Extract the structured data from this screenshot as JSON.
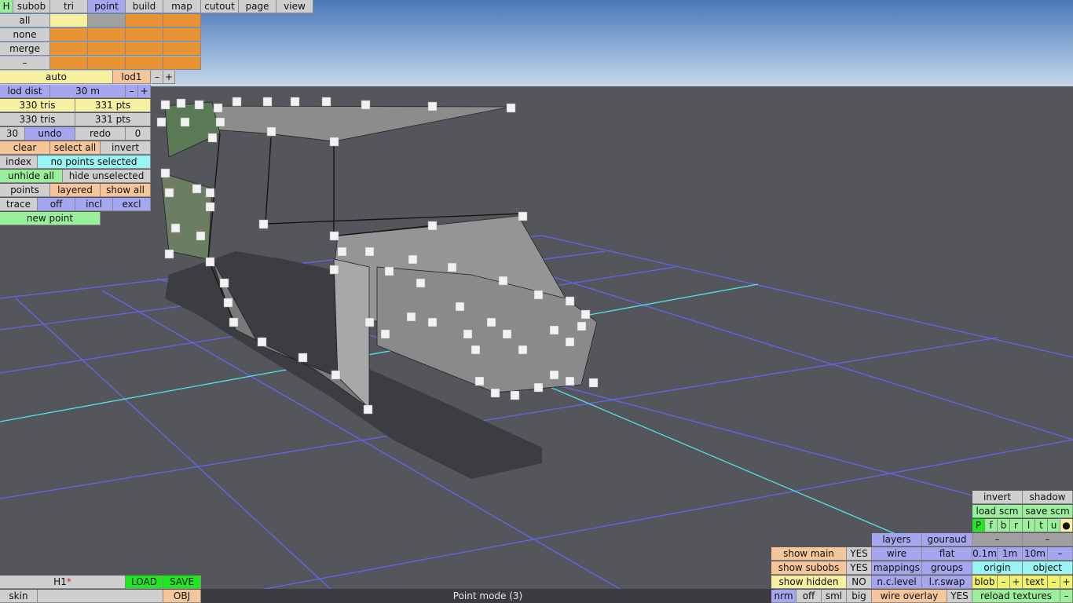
{
  "menu": {
    "h": "H",
    "subob": "subob",
    "tri": "tri",
    "point": "point",
    "build": "build",
    "map": "map",
    "cutout": "cutout",
    "page": "page",
    "view": "view"
  },
  "select": {
    "all": "all",
    "none": "none",
    "merge": "merge",
    "dash": "–"
  },
  "lod": {
    "auto": "auto",
    "level": "lod1",
    "minus": "–",
    "plus": "+",
    "dist_label": "lod dist",
    "dist_value": "30 m",
    "tris1": "330 tris",
    "pts1": "331 pts",
    "tris2": "330 tris",
    "pts2": "331 pts"
  },
  "edit": {
    "undo_count": "30",
    "undo": "undo",
    "redo": "redo",
    "redo_count": "0",
    "clear": "clear",
    "select_all": "select all",
    "invert": "invert",
    "index": "index",
    "selection_status": "no points selected",
    "unhide_all": "unhide all",
    "hide_unselected": "hide unselected",
    "points": "points",
    "layered": "layered",
    "show_all": "show all",
    "trace": "trace",
    "off": "off",
    "incl": "incl",
    "excl": "excl",
    "new_point": "new point"
  },
  "file": {
    "name": "H1",
    "modified_mark": "*",
    "load": "LOAD",
    "save": "SAVE",
    "skin": "skin",
    "obj": "OBJ"
  },
  "status": "Point mode (3)",
  "view": {
    "invert": "invert",
    "shadow": "shadow",
    "load_scm": "load scm",
    "save_scm": "save scm",
    "views": [
      "P",
      "f",
      "b",
      "r",
      "l",
      "t",
      "u",
      "●"
    ],
    "layers": "layers",
    "gouraud": "gouraud",
    "dash1": "–",
    "dash2": "–",
    "show_main": "show main",
    "show_main_val": "YES",
    "wire": "wire",
    "flat": "flat",
    "grid1": "0.1m",
    "grid2": "1m",
    "grid3": "10m",
    "grid_minus": "–",
    "show_subobs": "show subobs",
    "show_subobs_val": "YES",
    "mappings": "mappings",
    "groups": "groups",
    "origin": "origin",
    "object": "object",
    "show_hidden": "show hidden",
    "show_hidden_val": "NO",
    "nc_level": "n.c.level",
    "lr_swap": "l.r.swap",
    "blob": "blob",
    "blob_minus": "–",
    "blob_plus": "+",
    "text": "text",
    "text_minus": "–",
    "text_plus": "+",
    "nrm": "nrm",
    "off": "off",
    "sml": "sml",
    "big": "big",
    "wire_overlay": "wire overlay",
    "wire_overlay_val": "YES",
    "reload_textures": "reload textures",
    "reload_minus": "–"
  },
  "colors": {
    "sky_top": "#4a78b8",
    "sky_bottom": "#c4d8ec",
    "ground": "#55565c",
    "grid": "#6464f0",
    "axis": "#50e6e6"
  }
}
